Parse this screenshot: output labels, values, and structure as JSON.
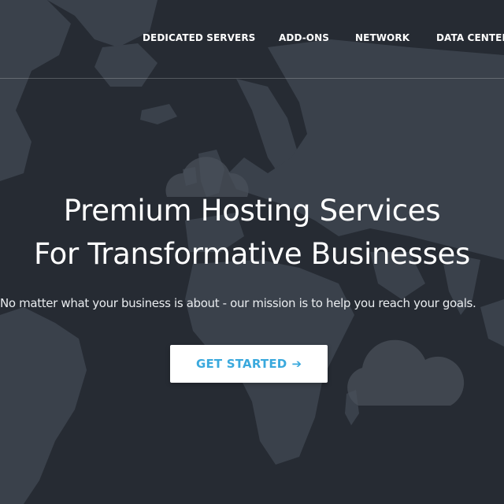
{
  "nav": {
    "items": [
      {
        "label": "DEDICATED SERVERS"
      },
      {
        "label": "ADD-ONS"
      },
      {
        "label": "NETWORK"
      },
      {
        "label": "DATA CENTER"
      }
    ]
  },
  "hero": {
    "headline_line1": "Premium Hosting Services",
    "headline_line2": "For Transformative Businesses",
    "subtitle": "No matter what your business is about - our mission is to help you reach your goals.",
    "cta_label": "GET STARTED",
    "cta_icon": "arrow-right-icon"
  },
  "colors": {
    "background": "#262b33",
    "map_land": "#3b424c",
    "accent": "#3aa9dd",
    "text": "#ffffff"
  }
}
